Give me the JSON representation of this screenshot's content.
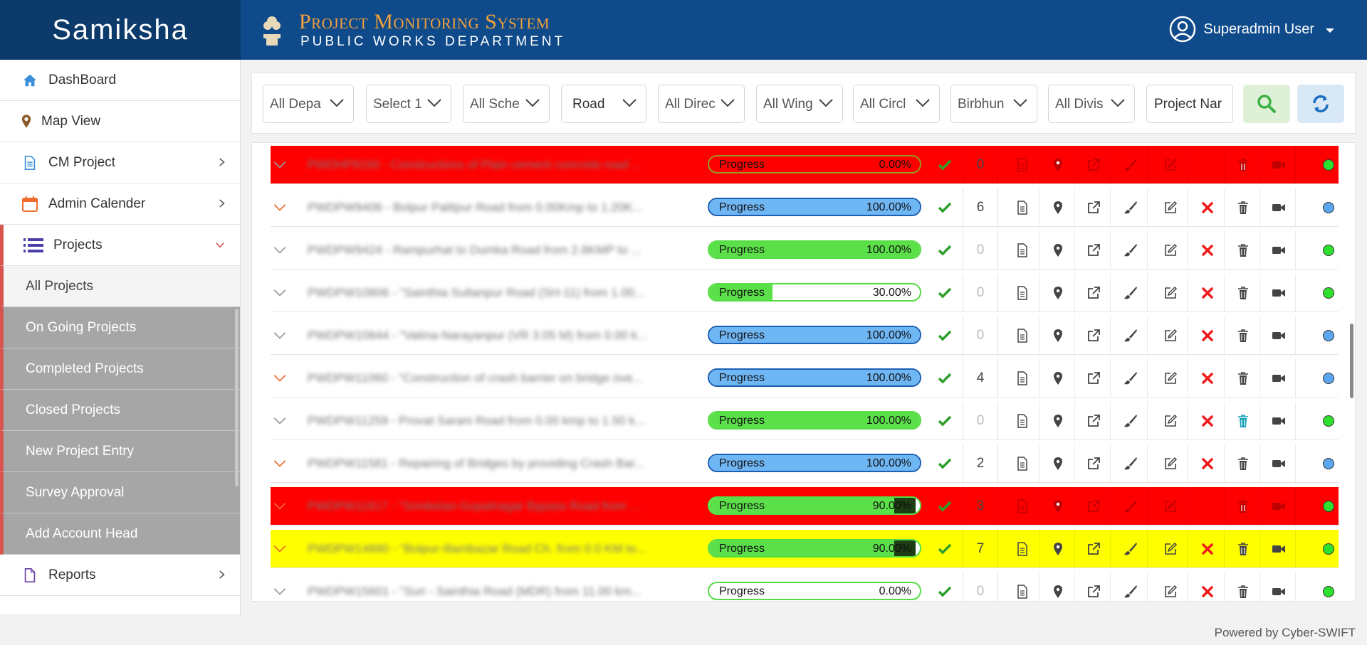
{
  "brand": "Samiksha",
  "header": {
    "title": "Project Monitoring System",
    "subtitle": "PUBLIC WORKS DEPARTMENT",
    "user": "Superadmin User"
  },
  "sidebar": {
    "items": [
      {
        "label": "DashBoard",
        "icon": "home-icon"
      },
      {
        "label": "Map View",
        "icon": "map-marker-icon"
      },
      {
        "label": "CM Project",
        "icon": "document-icon"
      },
      {
        "label": "Admin Calender",
        "icon": "calendar-icon"
      },
      {
        "label": "Projects",
        "icon": "list-icon"
      }
    ],
    "subitems": [
      {
        "label": "All Projects"
      },
      {
        "label": "On Going Projects"
      },
      {
        "label": "Completed Projects"
      },
      {
        "label": "Closed Projects"
      },
      {
        "label": "New Project Entry"
      },
      {
        "label": "Survey Approval"
      },
      {
        "label": "Add Account Head"
      }
    ],
    "reports": {
      "label": "Reports",
      "icon": "file-icon"
    }
  },
  "filters": {
    "department": "All Depa",
    "select": "Select 1",
    "scheme": "All Sche",
    "type": "Road",
    "directorate": "All Direc",
    "wing": "All Wing",
    "circle": "All Circl",
    "district": "Birbhun",
    "division": "All Divis",
    "project_name": "Project Nar"
  },
  "progress_label": "Progress",
  "rows": [
    {
      "name": "PWDHP9150 - Constructions of Plain cement concrete road ...",
      "pct": "0.00%",
      "count": "0",
      "bg": "red",
      "dot": "green",
      "chev": "grey"
    },
    {
      "name": "PWDPW9406 - Bolpur Palitpur Road from 0.00Kmp to 1.20K...",
      "pct": "100.00%",
      "count": "6",
      "bg": "",
      "dot": "blue",
      "chev": "orange"
    },
    {
      "name": "PWDPW9424 - Rampurhat to Dumka Road from 2.8KMP to ...",
      "pct": "100.00%",
      "count": "0",
      "bg": "",
      "dot": "green",
      "chev": "grey"
    },
    {
      "name": "PWDPW10806 - \"Sainthia Sultanpur Road (SH-11) from 1.00...",
      "pct": "30.00%",
      "count": "0",
      "bg": "",
      "dot": "green",
      "chev": "grey"
    },
    {
      "name": "PWDPW10844 - \"Vatina-Narayanpur (VR 3.05 M) from 0.00 k...",
      "pct": "100.00%",
      "count": "0",
      "bg": "",
      "dot": "blue",
      "chev": "grey"
    },
    {
      "name": "PWDPW11060 - \"Construction of crash barrier on bridge ove...",
      "pct": "100.00%",
      "count": "4",
      "bg": "",
      "dot": "blue",
      "chev": "orange"
    },
    {
      "name": "PWDPW11259 - Provat Sarani Road from 0.00 kmp to 1.50 k...",
      "pct": "100.00%",
      "count": "0",
      "bg": "",
      "dot": "green",
      "chev": "grey"
    },
    {
      "name": "PWDPW11581 - Repairing of Bridges by providing Crash Bar...",
      "pct": "100.00%",
      "count": "2",
      "bg": "",
      "dot": "blue",
      "chev": "orange"
    },
    {
      "name": "PWDPW11617 - \"Srinikelan-Gopalnagar Bypass Road from ...",
      "pct": "90.00%",
      "count": "3",
      "bg": "red",
      "dot": "green",
      "chev": "orange"
    },
    {
      "name": "PWDPW14890 - \"Bolpur-Illambazar Road Ch. from 0.0 KM to...",
      "pct": "90.00%",
      "count": "7",
      "bg": "yellow",
      "dot": "green",
      "chev": "orange"
    },
    {
      "name": "PWDPW15601 - \"Suri - Sainthia Road (MDR) from 11.00 km...",
      "pct": "0.00%",
      "count": "0",
      "bg": "",
      "dot": "green",
      "chev": "grey"
    }
  ],
  "row_levels": [
    0,
    100,
    100,
    30,
    100,
    100,
    100,
    100,
    90,
    90,
    0
  ],
  "row_bar_colors": [
    "none",
    "blue",
    "green",
    "green",
    "blue",
    "blue",
    "green",
    "blue",
    "green",
    "green",
    "green"
  ],
  "colors": {
    "brand_bg": "#0c3a6b",
    "header_bg": "#0f4a8a",
    "title_orange": "#f5a23a",
    "progress_green": "#5ce04a",
    "progress_blue": "#6fb6f4",
    "row_red": "#ff0000",
    "row_yellow": "#ffff00",
    "delete_red": "#ee1c1c"
  },
  "footer": "Powered by Cyber-SWIFT"
}
